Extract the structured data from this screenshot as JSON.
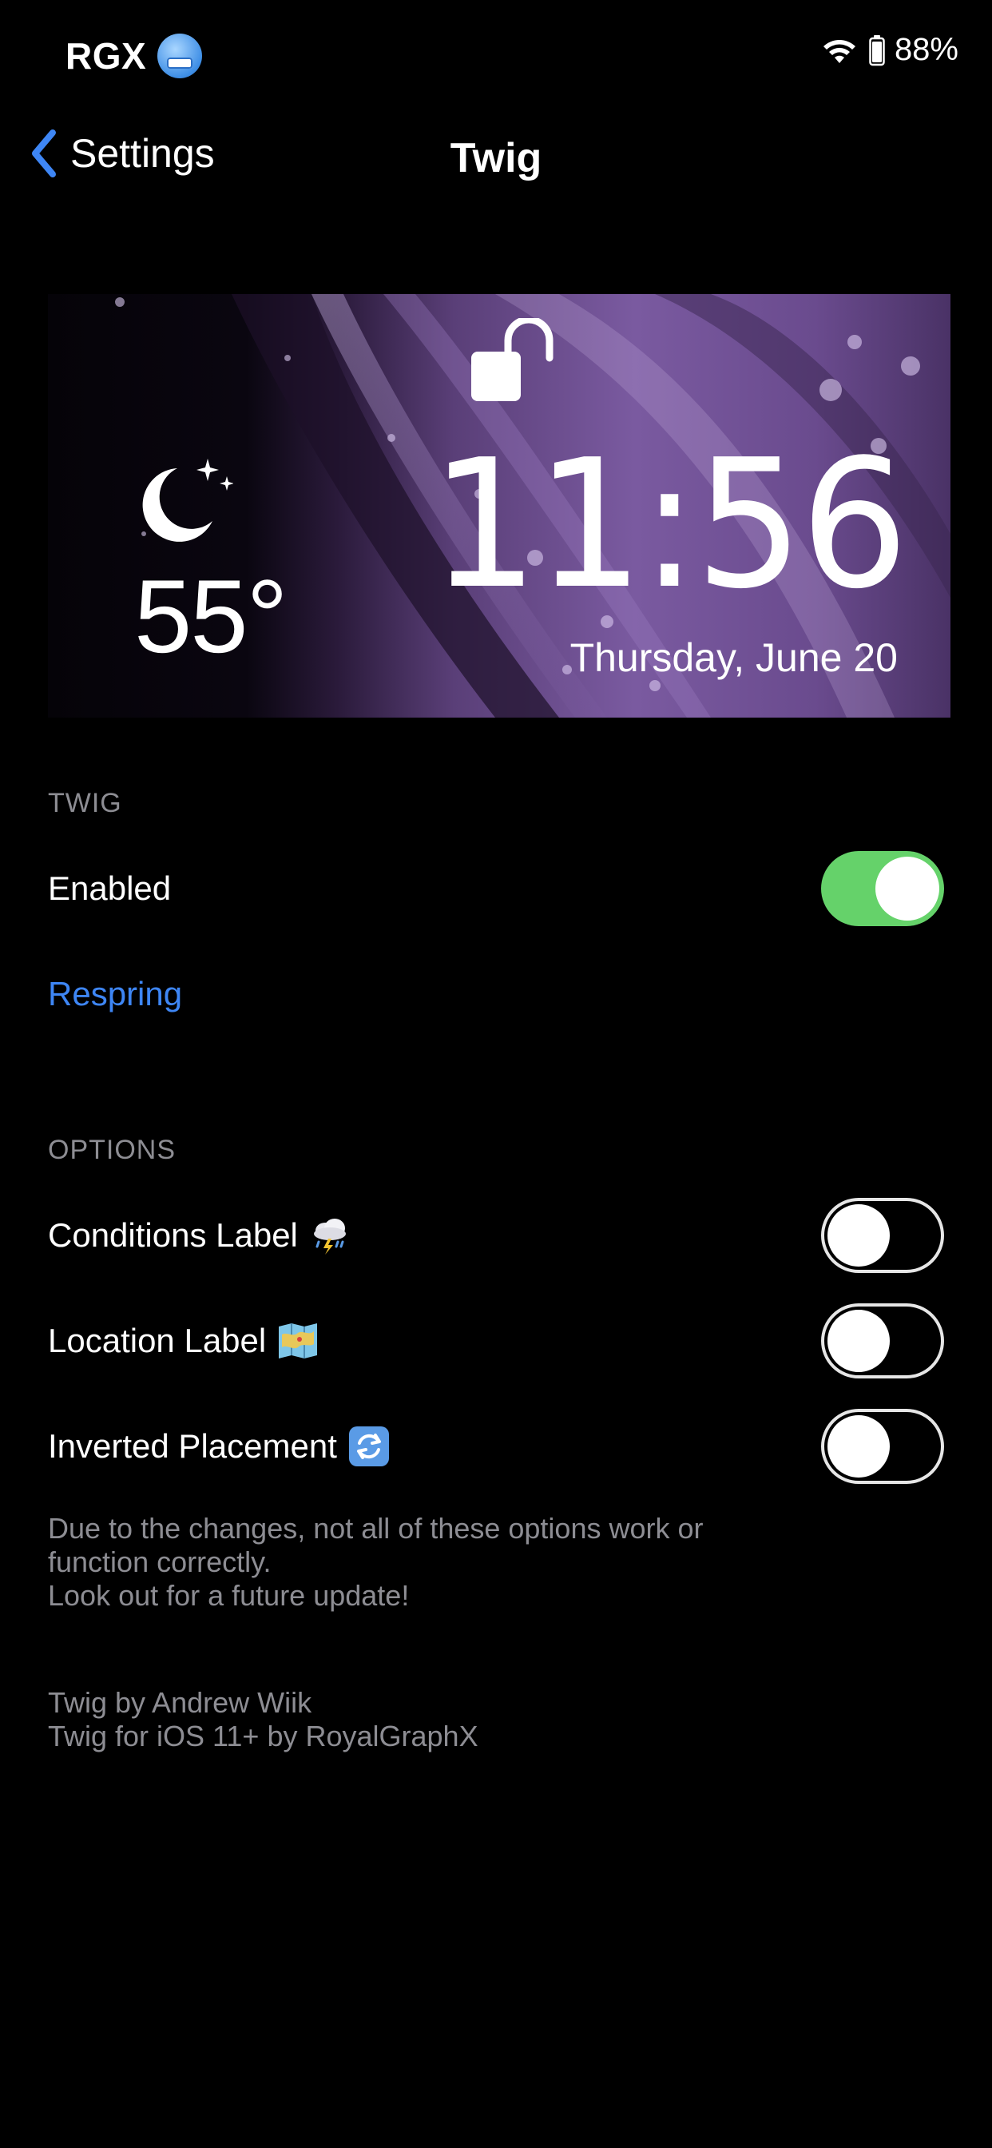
{
  "status_bar": {
    "carrier": "RGX",
    "battery_percent": "88%"
  },
  "nav": {
    "back_label": "Settings",
    "title": "Twig"
  },
  "banner": {
    "temperature": "55°",
    "time": "11:56",
    "date": "Thursday, June 20"
  },
  "twig_section": {
    "header": "TWIG",
    "enabled_label": "Enabled",
    "enabled_on": true,
    "respring_label": "Respring"
  },
  "options_section": {
    "header": "OPTIONS",
    "items": [
      {
        "label": "Conditions Label",
        "icon": "thunderstorm-icon",
        "on": false
      },
      {
        "label": "Location Label",
        "icon": "map-icon",
        "on": false
      },
      {
        "label": "Inverted Placement",
        "icon": "refresh-icon",
        "on": false
      }
    ],
    "note": "Due to the changes, not all of these options work or\nfunction correctly.\nLook out for a future update!"
  },
  "credits": {
    "line1": "Twig by Andrew Wiik",
    "line2": "Twig for iOS 11+ by RoyalGraphX"
  },
  "colors": {
    "toggle_on": "#65d26a",
    "link": "#3e86f5",
    "secondary_text": "#8d8d93"
  }
}
